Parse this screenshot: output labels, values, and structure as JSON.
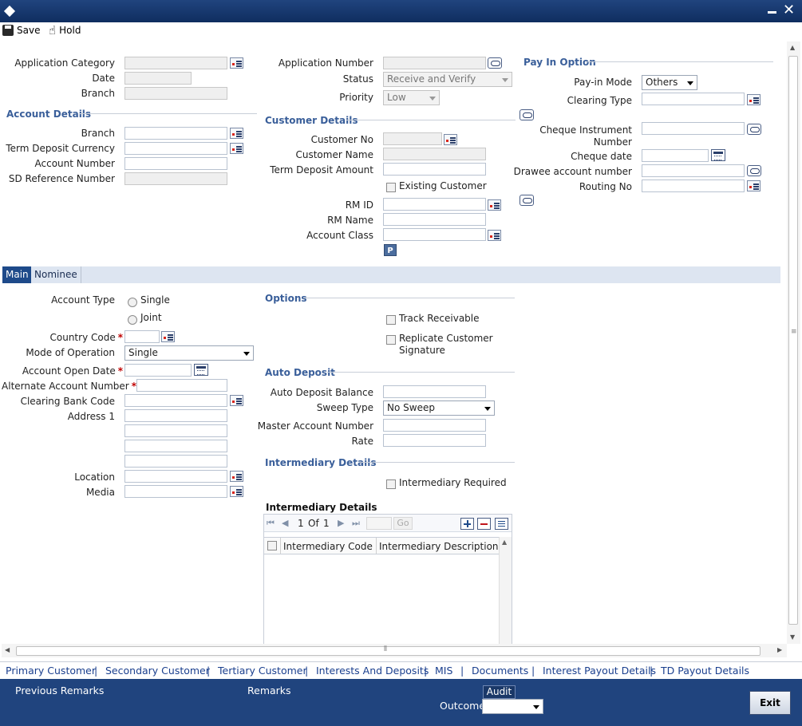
{
  "toolbar": {
    "save_label": "Save",
    "hold_label": "Hold"
  },
  "header": {
    "application_category_label": "Application Category",
    "date_label": "Date",
    "branch_label": "Branch",
    "application_number_label": "Application Number",
    "status_label": "Status",
    "status_value": "Receive and Verify",
    "priority_label": "Priority",
    "priority_value": "Low"
  },
  "pay_in": {
    "title": "Pay In Option",
    "pay_in_mode_label": "Pay-in Mode",
    "pay_in_mode_value": "Others",
    "clearing_type_label": "Clearing Type",
    "cheque_instrument_label_1": "Cheque Instrument",
    "cheque_instrument_label_2": "Number",
    "cheque_date_label": "Cheque date",
    "drawee_account_label": "Drawee account number",
    "routing_no_label": "Routing No"
  },
  "account_details": {
    "title": "Account Details",
    "branch_label": "Branch",
    "td_currency_label": "Term Deposit Currency",
    "account_number_label": "Account Number",
    "sd_reference_label": "SD Reference Number"
  },
  "customer_details": {
    "title": "Customer Details",
    "customer_no_label": "Customer No",
    "customer_name_label": "Customer Name",
    "td_amount_label": "Term Deposit Amount",
    "existing_customer_label": "Existing Customer",
    "rm_id_label": "RM ID",
    "rm_name_label": "RM Name",
    "account_class_label": "Account Class",
    "p_button_label": "P"
  },
  "tabs": [
    {
      "label": "Main"
    },
    {
      "label": "Nominee"
    }
  ],
  "main": {
    "account_type_label": "Account Type",
    "single_label": "Single",
    "joint_label": "Joint",
    "country_code_label": "Country Code",
    "mode_of_operation_label": "Mode of Operation",
    "mode_of_operation_value": "Single",
    "account_open_date_label": "Account Open Date",
    "alternate_account_label": "Alternate Account Number",
    "clearing_bank_code_label": "Clearing Bank Code",
    "address1_label": "Address 1",
    "location_label": "Location",
    "media_label": "Media",
    "required_mark": "*"
  },
  "options": {
    "title": "Options",
    "track_receivable_label": "Track Receivable",
    "replicate_sig_label_1": "Replicate Customer",
    "replicate_sig_label_2": "Signature"
  },
  "auto_deposit": {
    "title": "Auto Deposit",
    "balance_label": "Auto Deposit Balance",
    "sweep_type_label": "Sweep Type",
    "sweep_type_value": "No Sweep",
    "master_account_label": "Master Account Number",
    "rate_label": "Rate"
  },
  "intermediary": {
    "title": "Intermediary Details",
    "required_label": "Intermediary Required",
    "grid_title": "Intermediary Details",
    "page_current": "1",
    "page_of": "Of",
    "page_total": "1",
    "go_label": "Go",
    "col_code": "Intermediary Code",
    "col_description": "Intermediary Description"
  },
  "links": [
    "Primary Customer",
    "Secondary Customer",
    "Tertiary Customer",
    "Interests And Deposits",
    "MIS",
    "Documents",
    "Interest Payout Details",
    "TD Payout Details"
  ],
  "footer": {
    "previous_remarks_label": "Previous Remarks",
    "remarks_label": "Remarks",
    "audit_label": "Audit",
    "outcome_label": "Outcome",
    "exit_label": "Exit"
  },
  "icons": {
    "app": "diamond-icon",
    "minimize": "minimize-icon",
    "close": "close-icon",
    "save": "save-icon",
    "hold": "hand-icon",
    "lov": "lov-list-icon",
    "calendar": "calendar-icon",
    "detail": "speech-bubble-icon"
  },
  "colors": {
    "titlebar": "#20447e",
    "section": "#3a5f9a",
    "link": "#1a3f8e",
    "tab_active": "#1e4a8a",
    "required": "#c00000"
  }
}
